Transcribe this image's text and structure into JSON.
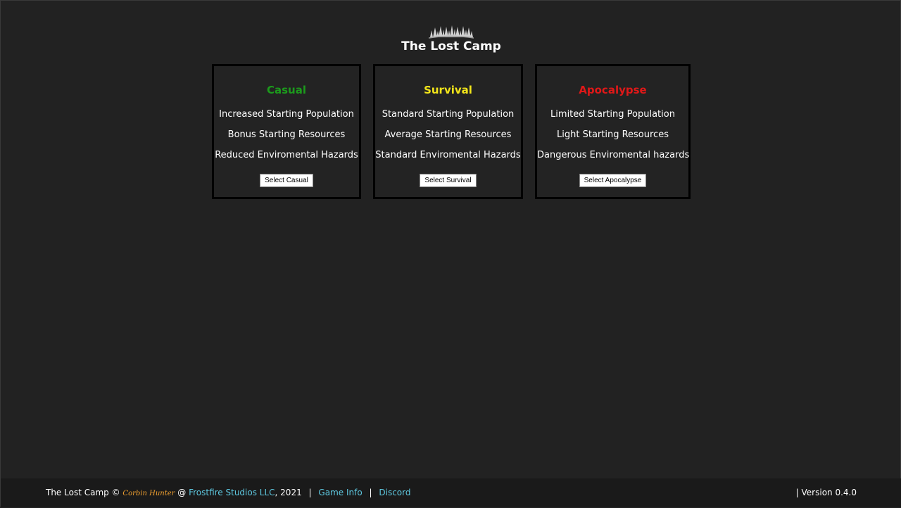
{
  "header": {
    "logo_icon": "pine-forest-icon",
    "title": "The Lost Camp"
  },
  "modes": [
    {
      "title": "Casual",
      "color": "#1c9a1c",
      "features": [
        "Increased Starting Population",
        "Bonus Starting Resources",
        "Reduced Enviromental Hazards"
      ],
      "button_label": "Select Casual"
    },
    {
      "title": "Survival",
      "color": "#f2e51a",
      "features": [
        "Standard Starting Population",
        "Average Starting Resources",
        "Standard Enviromental Hazards"
      ],
      "button_label": "Select Survival"
    },
    {
      "title": "Apocalypse",
      "color": "#e01818",
      "features": [
        "Limited Starting Population",
        "Light Starting Resources",
        "Dangerous Enviromental hazards"
      ],
      "button_label": "Select Apocalypse"
    }
  ],
  "footer": {
    "game_name": "The Lost Camp",
    "copyright_symbol": "©",
    "author": "Corbin Hunter",
    "at_symbol": "@",
    "studio": "Frostfire Studios LLC",
    "year": ", 2021",
    "separator": "|",
    "game_info_link": "Game Info",
    "discord_link": "Discord",
    "version": "| Version 0.4.0"
  }
}
